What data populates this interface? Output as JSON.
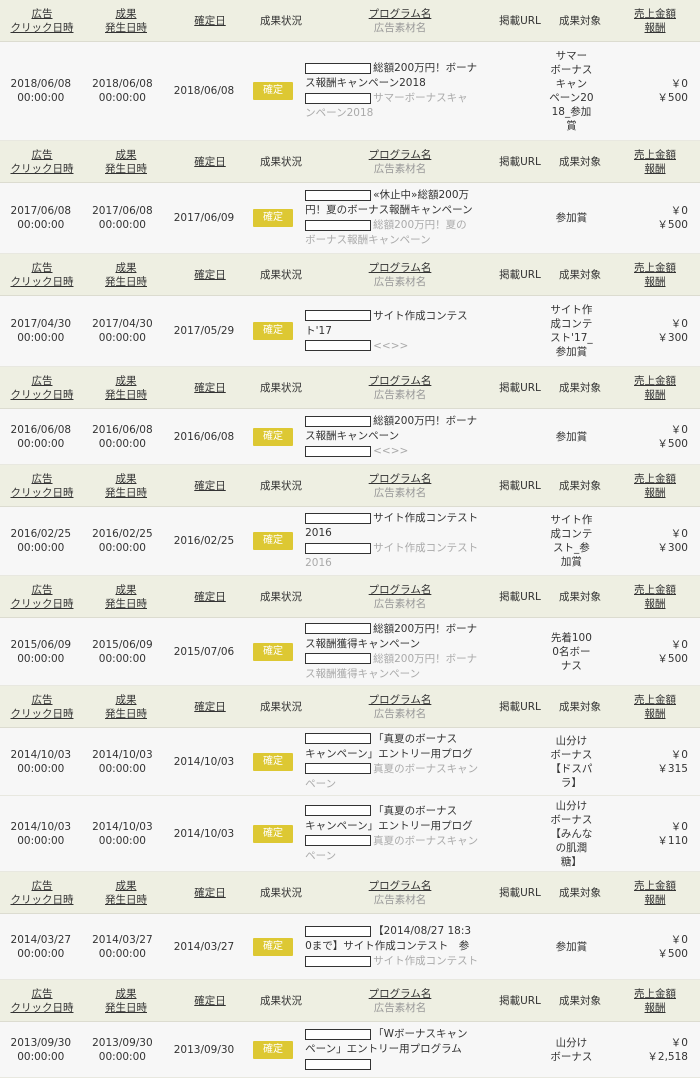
{
  "header": {
    "click_date": [
      "広告",
      "クリック日時"
    ],
    "occur_date": [
      "成果",
      "発生日時"
    ],
    "confirm_date": "確定日",
    "status": "成果状況",
    "program": "プログラム名",
    "ad_material": "広告素材名",
    "url": "掲載URL",
    "target": "成果対象",
    "amount": [
      "売上金額",
      "報酬"
    ]
  },
  "groups": [
    {
      "rows": [
        {
          "click_date": "2018/06/08",
          "click_time": "00:00:00",
          "occur_date": "2018/06/08",
          "occur_time": "00:00:00",
          "confirm_date": "2018/06/08",
          "status": "確定",
          "program_lines": [
            "総額200万円！ボーナ",
            "ス報酬キャンペーン2018"
          ],
          "ad_lines": [
            "サマーボーナスキャ",
            "ンペーン2018"
          ],
          "target_lines": [
            "サマー",
            "ボーナス",
            "キャン",
            "ペーン20",
            "18_参加",
            "賞"
          ],
          "sales": "￥0",
          "reward": "￥500"
        }
      ]
    },
    {
      "rows": [
        {
          "click_date": "2017/06/08",
          "click_time": "00:00:00",
          "occur_date": "2017/06/08",
          "occur_time": "00:00:00",
          "confirm_date": "2017/06/09",
          "status": "確定",
          "program_lines": [
            "«休止中»総額200万",
            "円！夏のボーナス報酬キャンペーン"
          ],
          "ad_lines": [
            "総額200万円！夏の",
            "ボーナス報酬キャンペーン"
          ],
          "target_lines": [
            "参加賞"
          ],
          "sales": "￥0",
          "reward": "￥500"
        }
      ]
    },
    {
      "rows": [
        {
          "click_date": "2017/04/30",
          "click_time": "00:00:00",
          "occur_date": "2017/04/30",
          "occur_time": "00:00:00",
          "confirm_date": "2017/05/29",
          "status": "確定",
          "program_lines": [
            "サイト作成コンテス",
            "ト'17"
          ],
          "ad_lines": [
            "<<>>"
          ],
          "target_lines": [
            "サイト作",
            "成コンテ",
            "スト'17_",
            "参加賞"
          ],
          "sales": "￥0",
          "reward": "￥300"
        }
      ]
    },
    {
      "rows": [
        {
          "click_date": "2016/06/08",
          "click_time": "00:00:00",
          "occur_date": "2016/06/08",
          "occur_time": "00:00:00",
          "confirm_date": "2016/06/08",
          "status": "確定",
          "program_lines": [
            "総額200万円！ボーナ",
            "ス報酬キャンペーン"
          ],
          "ad_lines": [
            "<<>>"
          ],
          "target_lines": [
            "参加賞"
          ],
          "sales": "￥0",
          "reward": "￥500"
        }
      ]
    },
    {
      "rows": [
        {
          "click_date": "2016/02/25",
          "click_time": "00:00:00",
          "occur_date": "2016/02/25",
          "occur_time": "00:00:00",
          "confirm_date": "2016/02/25",
          "status": "確定",
          "program_lines": [
            "サイト作成コンテスト",
            "2016"
          ],
          "ad_lines": [
            "サイト作成コンテスト",
            "2016"
          ],
          "target_lines": [
            "サイト作",
            "成コンテ",
            "スト_参",
            "加賞"
          ],
          "sales": "￥0",
          "reward": "￥300"
        }
      ]
    },
    {
      "rows": [
        {
          "click_date": "2015/06/09",
          "click_time": "00:00:00",
          "occur_date": "2015/06/09",
          "occur_time": "00:00:00",
          "confirm_date": "2015/07/06",
          "status": "確定",
          "program_lines": [
            "総額200万円！ボーナ",
            "ス報酬獲得キャンペーン"
          ],
          "ad_lines": [
            "総額200万円！ボーナ",
            "ス報酬獲得キャンペーン"
          ],
          "target_lines": [
            "先着100",
            "0名ボー",
            "ナス"
          ],
          "sales": "￥0",
          "reward": "￥500"
        }
      ]
    },
    {
      "rows": [
        {
          "click_date": "2014/10/03",
          "click_time": "00:00:00",
          "occur_date": "2014/10/03",
          "occur_time": "00:00:00",
          "confirm_date": "2014/10/03",
          "status": "確定",
          "program_lines": [
            "「真夏のボーナス",
            "キャンペーン」エントリー用プログ"
          ],
          "ad_lines": [
            "真夏のボーナスキャン",
            "ペーン"
          ],
          "target_lines": [
            "山分け",
            "ボーナス",
            "【ドスパ",
            "ラ】"
          ],
          "sales": "￥0",
          "reward": "￥315"
        },
        {
          "click_date": "2014/10/03",
          "click_time": "00:00:00",
          "occur_date": "2014/10/03",
          "occur_time": "00:00:00",
          "confirm_date": "2014/10/03",
          "status": "確定",
          "program_lines": [
            "「真夏のボーナス",
            "キャンペーン」エントリー用プログ"
          ],
          "ad_lines": [
            "真夏のボーナスキャン",
            "ペーン"
          ],
          "target_lines": [
            "山分け",
            "ボーナス",
            "【みんな",
            "の肌潤",
            "糖】"
          ],
          "sales": "￥0",
          "reward": "￥110"
        }
      ]
    },
    {
      "rows": [
        {
          "click_date": "2014/03/27",
          "click_time": "00:00:00",
          "occur_date": "2014/03/27",
          "occur_time": "00:00:00",
          "confirm_date": "2014/03/27",
          "status": "確定",
          "program_lines": [
            "【2014/08/27 18:3",
            "0まで】サイト作成コンテスト　参"
          ],
          "ad_lines": [
            "サイト作成コンテスト"
          ],
          "target_lines": [
            "参加賞"
          ],
          "sales": "￥0",
          "reward": "￥500"
        }
      ]
    },
    {
      "rows": [
        {
          "click_date": "2013/09/30",
          "click_time": "00:00:00",
          "occur_date": "2013/09/30",
          "occur_time": "00:00:00",
          "confirm_date": "2013/09/30",
          "status": "確定",
          "program_lines": [
            "「Wボーナスキャン",
            "ペーン」エントリー用プログラム"
          ],
          "ad_lines": [
            ""
          ],
          "target_lines": [
            "山分け",
            "ボーナス"
          ],
          "sales": "￥0",
          "reward": "￥2,518"
        }
      ]
    }
  ]
}
